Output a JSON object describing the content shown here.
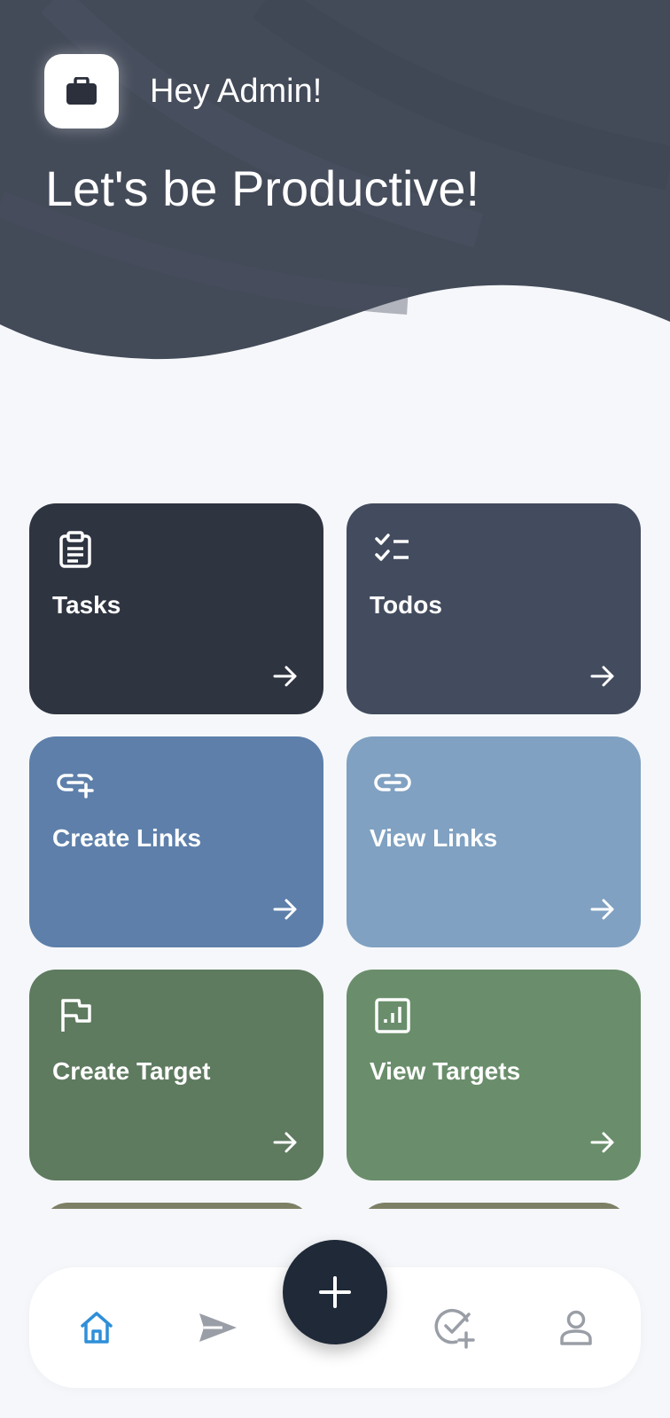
{
  "header": {
    "greeting": "Hey Admin!",
    "headline": "Let's be Productive!",
    "app_icon": "briefcase-icon",
    "bg_color": "#434a58"
  },
  "tiles": [
    {
      "label": "Tasks",
      "icon": "clipboard-list-icon",
      "color": "#2f3441"
    },
    {
      "label": "Todos",
      "icon": "checklist-icon",
      "color": "#434c5e"
    },
    {
      "label": "Create Links",
      "icon": "link-plus-icon",
      "color": "#5d7faa"
    },
    {
      "label": "View Links",
      "icon": "link-icon",
      "color": "#80a1c1"
    },
    {
      "label": "Create Target",
      "icon": "flag-icon",
      "color": "#5e7a5f"
    },
    {
      "label": "View Targets",
      "icon": "bar-chart-icon",
      "color": "#6a8e6b"
    }
  ],
  "partial_tile_color": "#7d8065",
  "bottom_nav": {
    "items": [
      {
        "icon": "home-icon",
        "active": true
      },
      {
        "icon": "send-icon",
        "active": false
      },
      {
        "icon": "check-circle-plus-icon",
        "active": false
      },
      {
        "icon": "user-icon",
        "active": false
      }
    ],
    "fab_icon": "plus-icon",
    "active_color": "#2f8fd8",
    "inactive_color": "#9a9ea6"
  }
}
